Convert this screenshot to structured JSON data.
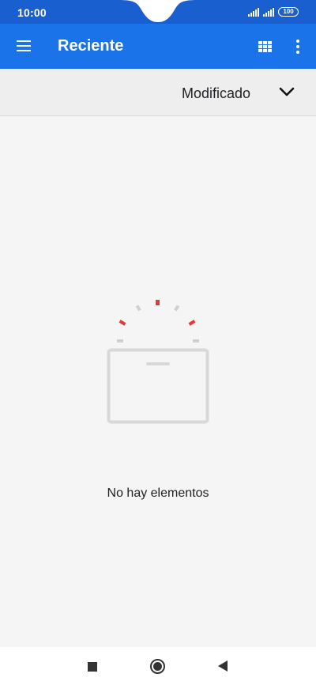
{
  "status_bar": {
    "time": "10:00",
    "battery": "100",
    "icons": [
      "signal-icon",
      "signal-icon",
      "battery-icon"
    ]
  },
  "app_bar": {
    "title": "Reciente",
    "icons": [
      "menu-icon",
      "grid-view-icon",
      "more-vert-icon"
    ]
  },
  "sort_bar": {
    "label": "Modificado",
    "icon": "chevron-down-icon"
  },
  "empty_state": {
    "message": "No hay elementos",
    "icon": "empty-box-icon",
    "accent_color": "#e53935"
  },
  "nav_bar": {
    "icons": [
      "recents-square-icon",
      "home-circle-icon",
      "back-triangle-icon"
    ]
  },
  "colors": {
    "status_bar": "#1a5fd0",
    "app_bar": "#1a73e8",
    "sort_bar": "#eeeeee",
    "background": "#f5f5f5"
  }
}
